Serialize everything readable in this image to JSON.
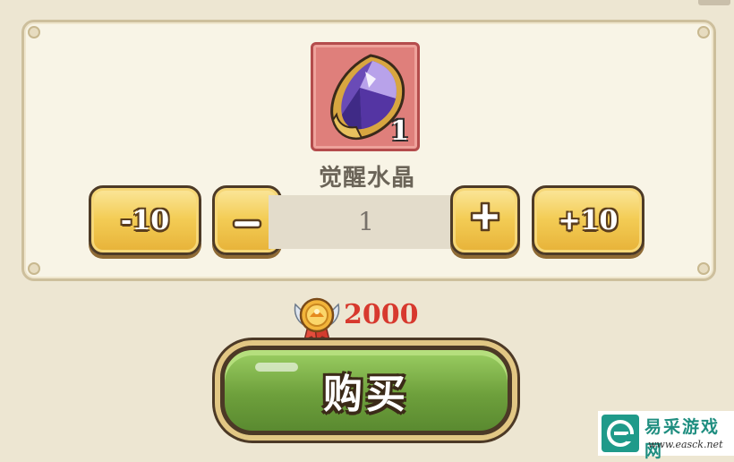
{
  "item": {
    "name": "觉醒水晶",
    "count": "1",
    "icon": "purple-crystal-icon",
    "tile_color": "#df7f7b"
  },
  "quantity": {
    "value": "1",
    "minus10_label": "-10",
    "minus_label": "−",
    "plus_label": "+",
    "plus10_label": "+10"
  },
  "price": {
    "currency_icon": "medal-coin-icon",
    "amount": "2000",
    "color": "#d7392e"
  },
  "buy_button": {
    "label": "购买",
    "color": "#6ea03c"
  },
  "watermark": {
    "title": "易采游戏网",
    "url": "www.easck.net"
  }
}
